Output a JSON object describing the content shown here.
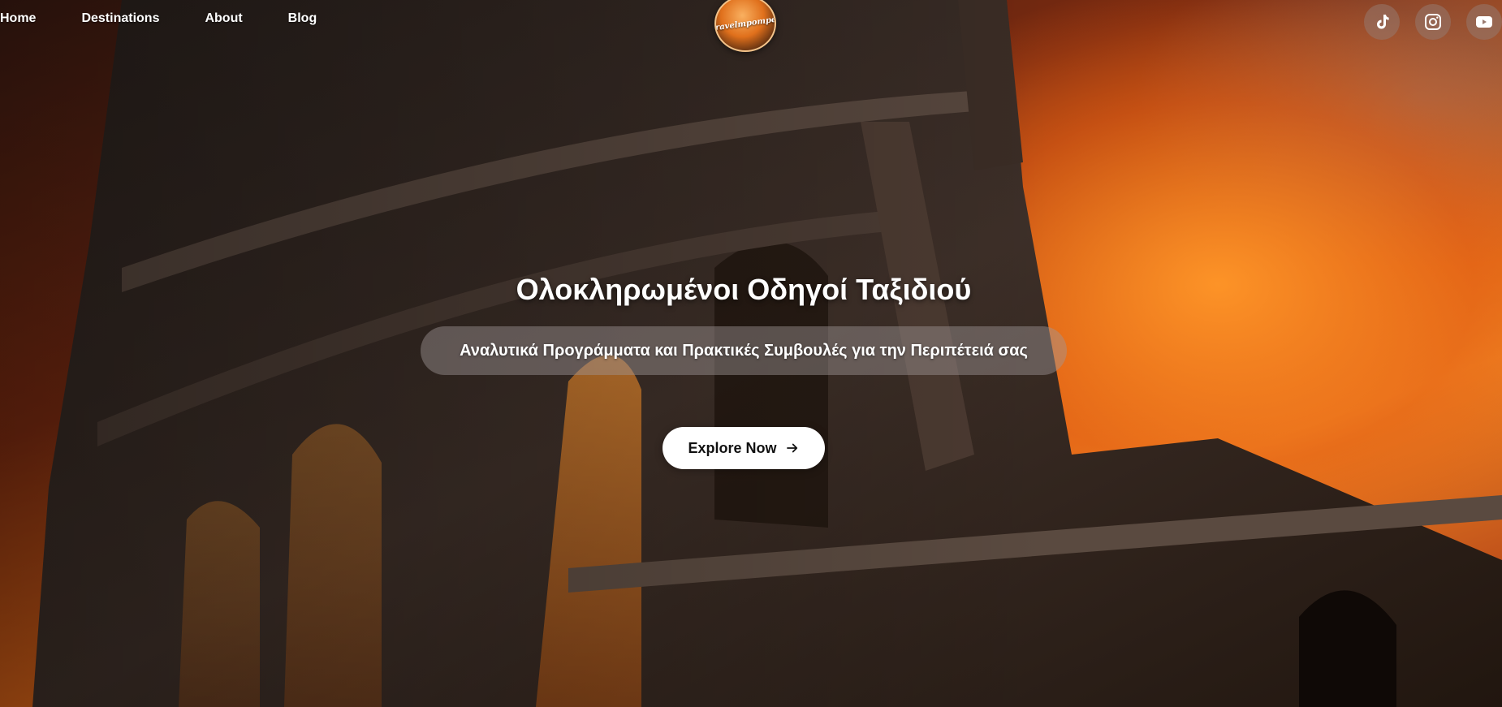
{
  "nav": {
    "items": [
      {
        "label": "Home"
      },
      {
        "label": "Destinations"
      },
      {
        "label": "About"
      },
      {
        "label": "Blog"
      }
    ]
  },
  "logo": {
    "text": "Travelmpompes"
  },
  "social": {
    "items": [
      {
        "icon": "tiktok-icon"
      },
      {
        "icon": "instagram-icon"
      },
      {
        "icon": "youtube-icon"
      }
    ]
  },
  "hero": {
    "title": "Ολοκληρωμένοι Οδηγοί Ταξιδιού",
    "subtitle": "Αναλυτικά Προγράμματα και Πρακτικές Συμβουλές για την Περιπέτειά σας",
    "cta_label": "Explore Now",
    "cta_icon": "arrow-right-icon",
    "background_image": "colosseum-at-sunset"
  },
  "colors": {
    "cta_bg": "#ffffff",
    "text": "#ffffff",
    "sky_accent": "#f08a25"
  }
}
